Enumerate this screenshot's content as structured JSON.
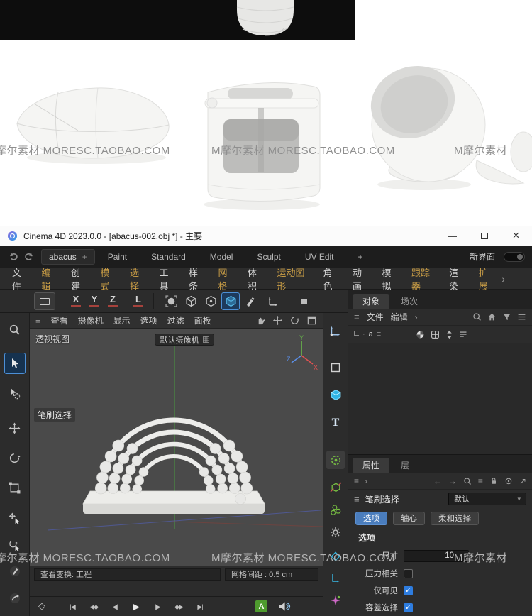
{
  "colors": {
    "menu_accent": "#c59a45",
    "selection_blue": "#4a7dbd",
    "checkbox_blue": "#2e7de0",
    "autokey_green": "#4e9b2e",
    "axis_x": "#e05252",
    "axis_y": "#6abf4b",
    "axis_z": "#5b8fe8"
  },
  "icons": {
    "hamburger": "≡",
    "chevron_right": "›",
    "chevron_down": "▾",
    "spinner_up": "▴",
    "spinner_down": "▾",
    "check": "✓",
    "dot": "·",
    "minimize": "—",
    "close": "×",
    "arrow_left": "←",
    "arrow_right": "→",
    "arrow_up_right": "↗",
    "key_diamond": "◇",
    "text_tool": "T",
    "plus": "+"
  },
  "watermarks": {
    "left": "摩尔素材  MORESC.TAOBAO.COM",
    "center": "M摩尔素材  MORESC.TAOBAO.COM",
    "right": "M摩尔素材"
  },
  "titlebar": {
    "title": "Cinema 4D 2023.0.0 - [abacus-002.obj *] - 主要"
  },
  "layout_bar": {
    "doc_tab": "abacus",
    "add": "+",
    "presets": [
      "Paint",
      "Standard",
      "Model",
      "Sculpt",
      "UV Edit"
    ],
    "add2": "+",
    "new_ui": "新界面"
  },
  "menubar": {
    "items": [
      {
        "label": "文件",
        "accent": false
      },
      {
        "label": "编辑",
        "accent": true
      },
      {
        "label": "创建",
        "accent": false
      },
      {
        "label": "模式",
        "accent": true
      },
      {
        "label": "选择",
        "accent": true
      },
      {
        "label": "工具",
        "accent": false
      },
      {
        "label": "样条",
        "accent": false
      },
      {
        "label": "网格",
        "accent": true
      },
      {
        "label": "体积",
        "accent": false
      },
      {
        "label": "运动图形",
        "accent": true
      },
      {
        "label": "角色",
        "accent": false
      },
      {
        "label": "动画",
        "accent": false
      },
      {
        "label": "模拟",
        "accent": false
      },
      {
        "label": "跟踪器",
        "accent": true
      },
      {
        "label": "渲染",
        "accent": false
      },
      {
        "label": "扩展",
        "accent": true
      }
    ],
    "overflow": "›"
  },
  "axis_toolbar": {
    "x": "X",
    "y": "Y",
    "z": "Z",
    "coord": "L"
  },
  "viewport": {
    "menu": [
      "查看",
      "摄像机",
      "显示",
      "选项",
      "过滤",
      "面板"
    ],
    "view_label": "透视视图",
    "camera_dropdown": "默认摄像机",
    "tool_hint": "笔刷选择",
    "axis": {
      "x": "X",
      "y": "Y",
      "z": "Z"
    },
    "status_left": "查看变换: 工程",
    "status_right": "网格间距 : 0.5 cm"
  },
  "object_panel": {
    "tabs": [
      "对象",
      "场次"
    ],
    "menu": [
      "文件",
      "编辑"
    ],
    "overflow": "›",
    "object_label": "a"
  },
  "attribute_panel": {
    "tabs": [
      "属性",
      "层"
    ],
    "tool_title": "笔刷选择",
    "preset_dropdown": "默认",
    "mode_buttons": [
      "选项",
      "轴心",
      "柔和选择"
    ],
    "section": "选项",
    "size_label": "尺寸",
    "size_value": "10",
    "checkboxes": [
      {
        "label": "压力相关",
        "checked": false
      },
      {
        "label": "仅可见",
        "checked": true
      },
      {
        "label": "容差选择",
        "checked": true
      }
    ]
  },
  "timeline": {
    "transport": [
      "|◀",
      "◀◆",
      "◀|",
      "▶",
      "|▶",
      "◆▶",
      "▶|"
    ],
    "autokey": "A"
  }
}
